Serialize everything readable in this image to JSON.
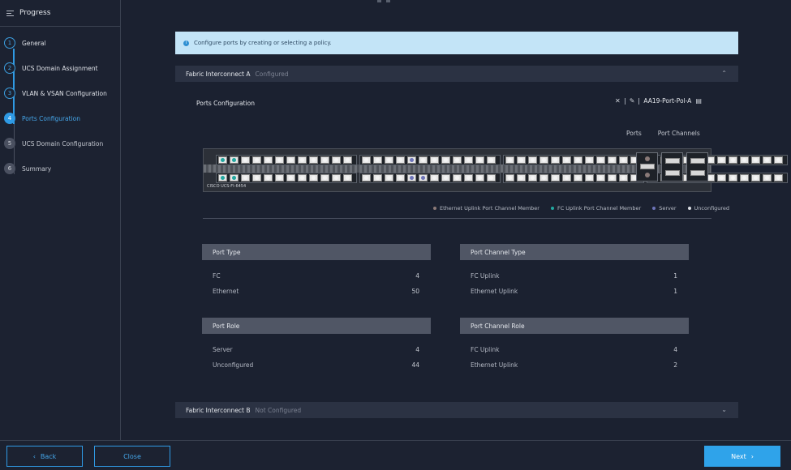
{
  "sidebar": {
    "title": "Progress",
    "steps": [
      {
        "num": "1",
        "label": "General"
      },
      {
        "num": "2",
        "label": "UCS Domain Assignment"
      },
      {
        "num": "3",
        "label": "VLAN & VSAN Configuration"
      },
      {
        "num": "4",
        "label": "Ports Configuration"
      },
      {
        "num": "5",
        "label": "UCS Domain Configuration"
      },
      {
        "num": "6",
        "label": "Summary"
      }
    ]
  },
  "banner": {
    "text": "Configure ports by creating or selecting a policy."
  },
  "fi_a": {
    "name": "Fabric Interconnect A",
    "status": "Configured"
  },
  "fi_b": {
    "name": "Fabric Interconnect B",
    "status": "Not Configured"
  },
  "ports_config": {
    "title": "Ports Configuration",
    "policy_name": "AA19-Port-Pol-A",
    "tabs": [
      "Ports",
      "Port Channels"
    ]
  },
  "switch": {
    "model": "CISCO UCS-FI-6454"
  },
  "legend": [
    {
      "label": "Ethernet Uplink Port Channel Member",
      "color": "#8c7a78"
    },
    {
      "label": "FC Uplink Port Channel Member",
      "color": "#22a7a0"
    },
    {
      "label": "Server",
      "color": "#6d74b8"
    },
    {
      "label": "Unconfigured",
      "color": "#dcdfe5"
    }
  ],
  "port_type": {
    "header": "Port Type",
    "rows": [
      {
        "k": "FC",
        "v": "4"
      },
      {
        "k": "Ethernet",
        "v": "50"
      }
    ]
  },
  "port_channel_type": {
    "header": "Port Channel Type",
    "rows": [
      {
        "k": "FC Uplink",
        "v": "1"
      },
      {
        "k": "Ethernet Uplink",
        "v": "1"
      }
    ]
  },
  "port_role": {
    "header": "Port Role",
    "rows": [
      {
        "k": "Server",
        "v": "4"
      },
      {
        "k": "Unconfigured",
        "v": "44"
      }
    ]
  },
  "port_channel_role": {
    "header": "Port Channel Role",
    "rows": [
      {
        "k": "FC Uplink",
        "v": "4"
      },
      {
        "k": "Ethernet Uplink",
        "v": "2"
      }
    ]
  },
  "footer": {
    "back": "Back",
    "close": "Close",
    "next": "Next"
  }
}
